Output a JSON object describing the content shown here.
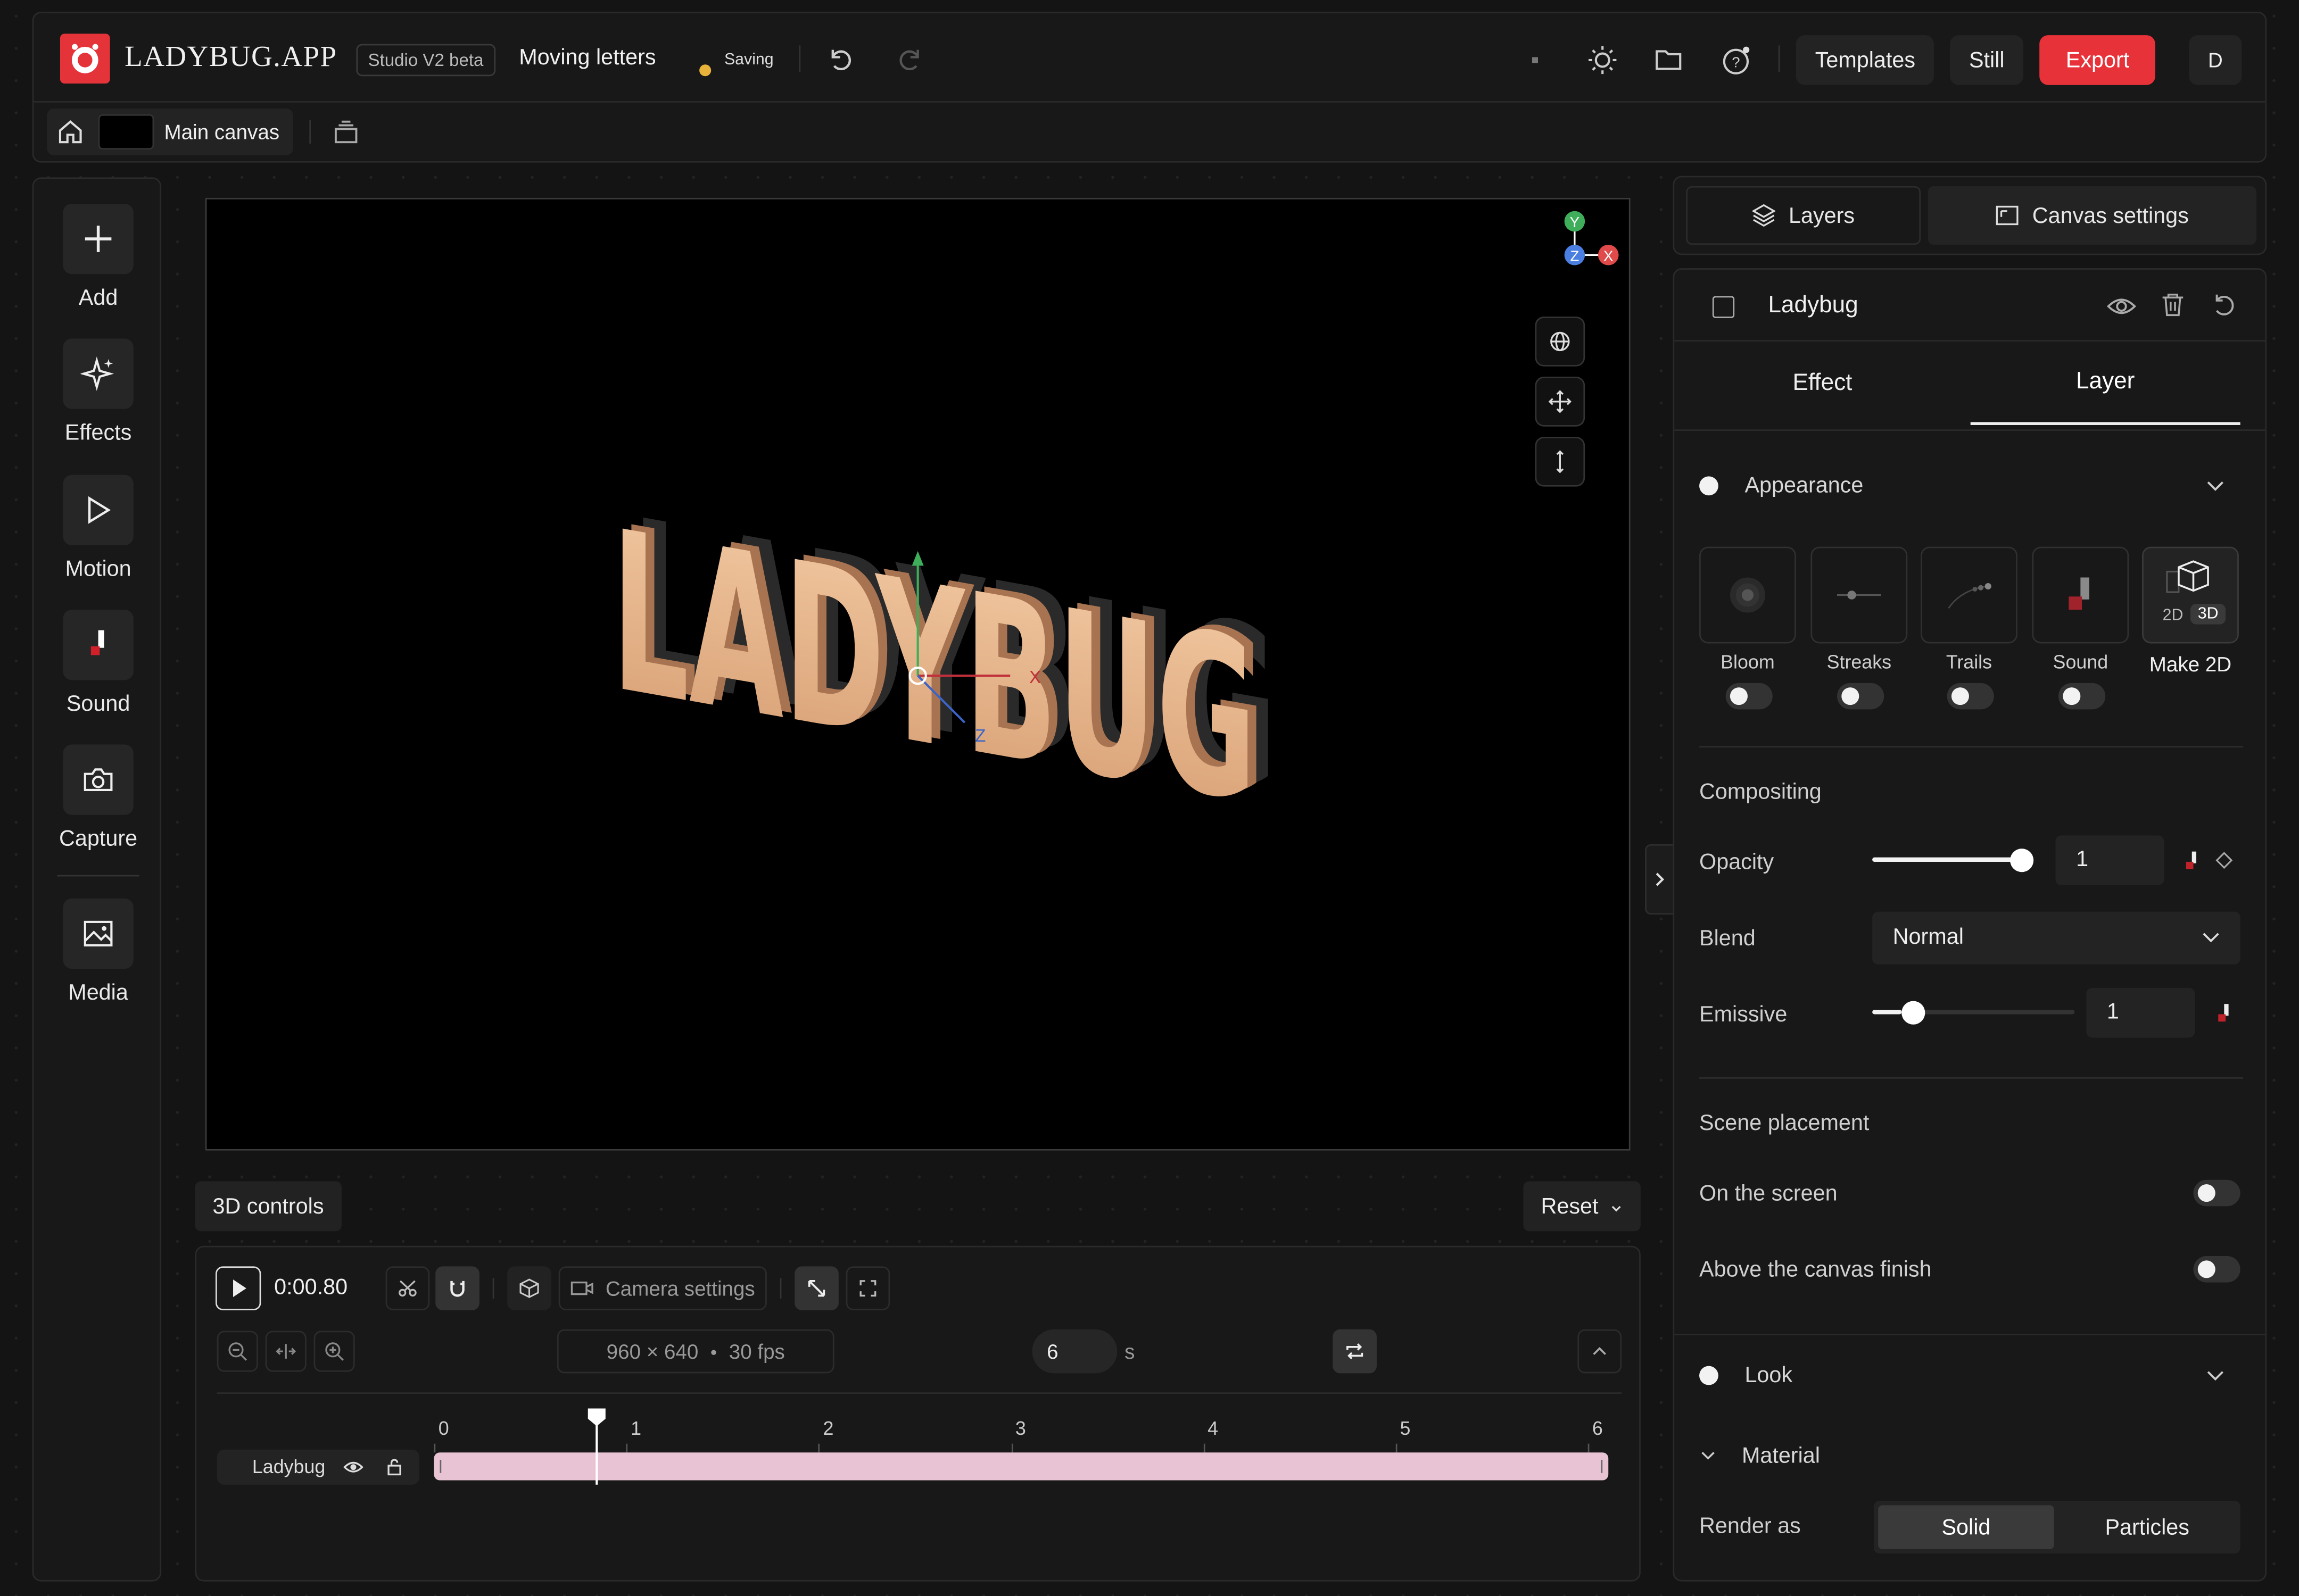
{
  "app": {
    "logo_text": "LADYBUG.APP",
    "badge": "Studio V2 beta",
    "project_title": "Moving letters",
    "save_status": "Saving",
    "accent_color": "#e8323a",
    "save_status_color": "#e8b23a"
  },
  "header": {
    "templates_label": "Templates",
    "still_label": "Still",
    "export_label": "Export",
    "avatar_initial": "D",
    "icons": [
      "undo-icon",
      "redo-icon",
      "dot-icon",
      "sun-icon",
      "folder-icon",
      "help-icon"
    ]
  },
  "breadcrumb": {
    "canvas_label": "Main canvas"
  },
  "toolbar": {
    "items": [
      {
        "label": "Add",
        "icon": "plus-icon"
      },
      {
        "label": "Effects",
        "icon": "sparkle-icon"
      },
      {
        "label": "Motion",
        "icon": "play-icon"
      },
      {
        "label": "Sound",
        "icon": "sound-icon"
      },
      {
        "label": "Capture",
        "icon": "camera-icon"
      },
      {
        "label": "Media",
        "icon": "image-icon"
      }
    ]
  },
  "canvas": {
    "text_3d": "LADYBUG",
    "axis_labels": {
      "x": "X",
      "y": "Y",
      "z": "Z"
    }
  },
  "controls": {
    "three_d_label": "3D controls",
    "reset_label": "Reset"
  },
  "timeline": {
    "time": "0:00.80",
    "camera_settings_label": "Camera settings",
    "resolution": "960 × 640",
    "fps": "30 fps",
    "duration": "6",
    "duration_unit": "s",
    "ticks": [
      "0",
      "1",
      "2",
      "3",
      "4",
      "5",
      "6"
    ],
    "track_name": "Ladybug",
    "track_color": "#e8c3d4",
    "playhead_seconds": 0.8,
    "total_seconds": 6
  },
  "right_tabs": {
    "layers_label": "Layers",
    "canvas_settings_label": "Canvas settings"
  },
  "layer": {
    "name": "Ladybug",
    "tabs": {
      "effect": "Effect",
      "layer": "Layer"
    },
    "appearance": {
      "heading": "Appearance",
      "effects": [
        {
          "label": "Bloom",
          "on": false
        },
        {
          "label": "Streaks",
          "on": false
        },
        {
          "label": "Trails",
          "on": false
        },
        {
          "label": "Sound",
          "on": false
        }
      ],
      "dim_2d": "2D",
      "dim_3d": "3D",
      "make_2d_label": "Make 2D"
    },
    "compositing": {
      "heading": "Compositing",
      "opacity_label": "Opacity",
      "opacity_value": "1",
      "opacity_fraction": 1.0,
      "blend_label": "Blend",
      "blend_value": "Normal",
      "emissive_label": "Emissive",
      "emissive_value": "1",
      "emissive_fraction": 0.15
    },
    "scene_placement": {
      "heading": "Scene placement",
      "on_screen_label": "On the screen",
      "above_canvas_label": "Above the canvas finish"
    },
    "look": {
      "heading": "Look",
      "material_label": "Material",
      "render_as_label": "Render as",
      "render_options": [
        "Solid",
        "Particles"
      ],
      "selected": "Solid"
    }
  }
}
